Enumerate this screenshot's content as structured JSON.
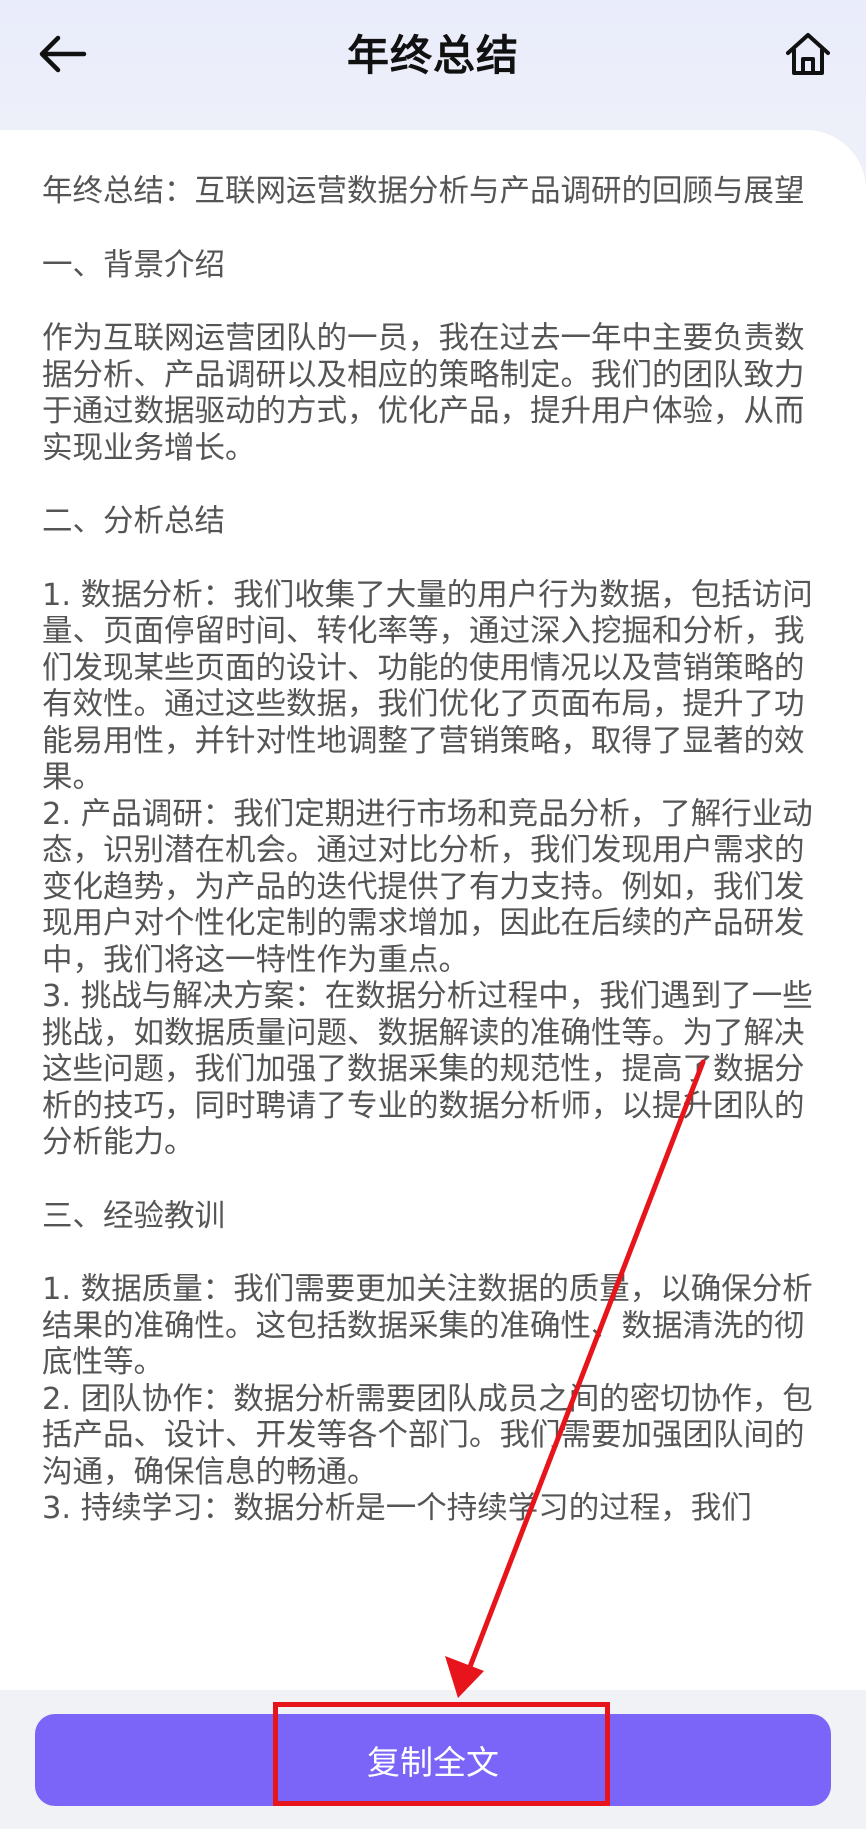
{
  "header": {
    "title": "年终总结",
    "back_icon": "arrow-left-icon",
    "home_icon": "home-icon"
  },
  "content": {
    "paragraphs": [
      "年终总结：互联网运营数据分析与产品调研的回顾与展望",
      "一、背景介绍",
      "作为互联网运营团队的一员，我在过去一年中主要负责数据分析、产品调研以及相应的策略制定。我们的团队致力于通过数据驱动的方式，优化产品，提升用户体验，从而实现业务增长。",
      "二、分析总结",
      "1. 数据分析：我们收集了大量的用户行为数据，包括访问量、页面停留时间、转化率等，通过深入挖掘和分析，我们发现某些页面的设计、功能的使用情况以及营销策略的有效性。通过这些数据，我们优化了页面布局，提升了功能易用性，并针对性地调整了营销策略，取得了显著的效果。",
      "2. 产品调研：我们定期进行市场和竞品分析，了解行业动态，识别潜在机会。通过对比分析，我们发现用户需求的变化趋势，为产品的迭代提供了有力支持。例如，我们发现用户对个性化定制的需求增加，因此在后续的产品研发中，我们将这一特性作为重点。",
      "3. 挑战与解决方案：在数据分析过程中，我们遇到了一些挑战，如数据质量问题、数据解读的准确性等。为了解决这些问题，我们加强了数据采集的规范性，提高了数据分析的技巧，同时聘请了专业的数据分析师，以提升团队的分析能力。",
      "三、经验教训",
      "1. 数据质量：我们需要更加关注数据的质量，以确保分析结果的准确性。这包括数据采集的准确性、数据清洗的彻底性等。",
      "2. 团队协作：数据分析需要团队成员之间的密切协作，包括产品、设计、开发等各个部门。我们需要加强团队间的沟通，确保信息的畅通。",
      "3. 持续学习：数据分析是一个持续学习的过程，我们"
    ]
  },
  "footer": {
    "copy_label": "复制全文"
  },
  "colors": {
    "accent": "#7b64f8",
    "annotation": "#e8141b"
  }
}
